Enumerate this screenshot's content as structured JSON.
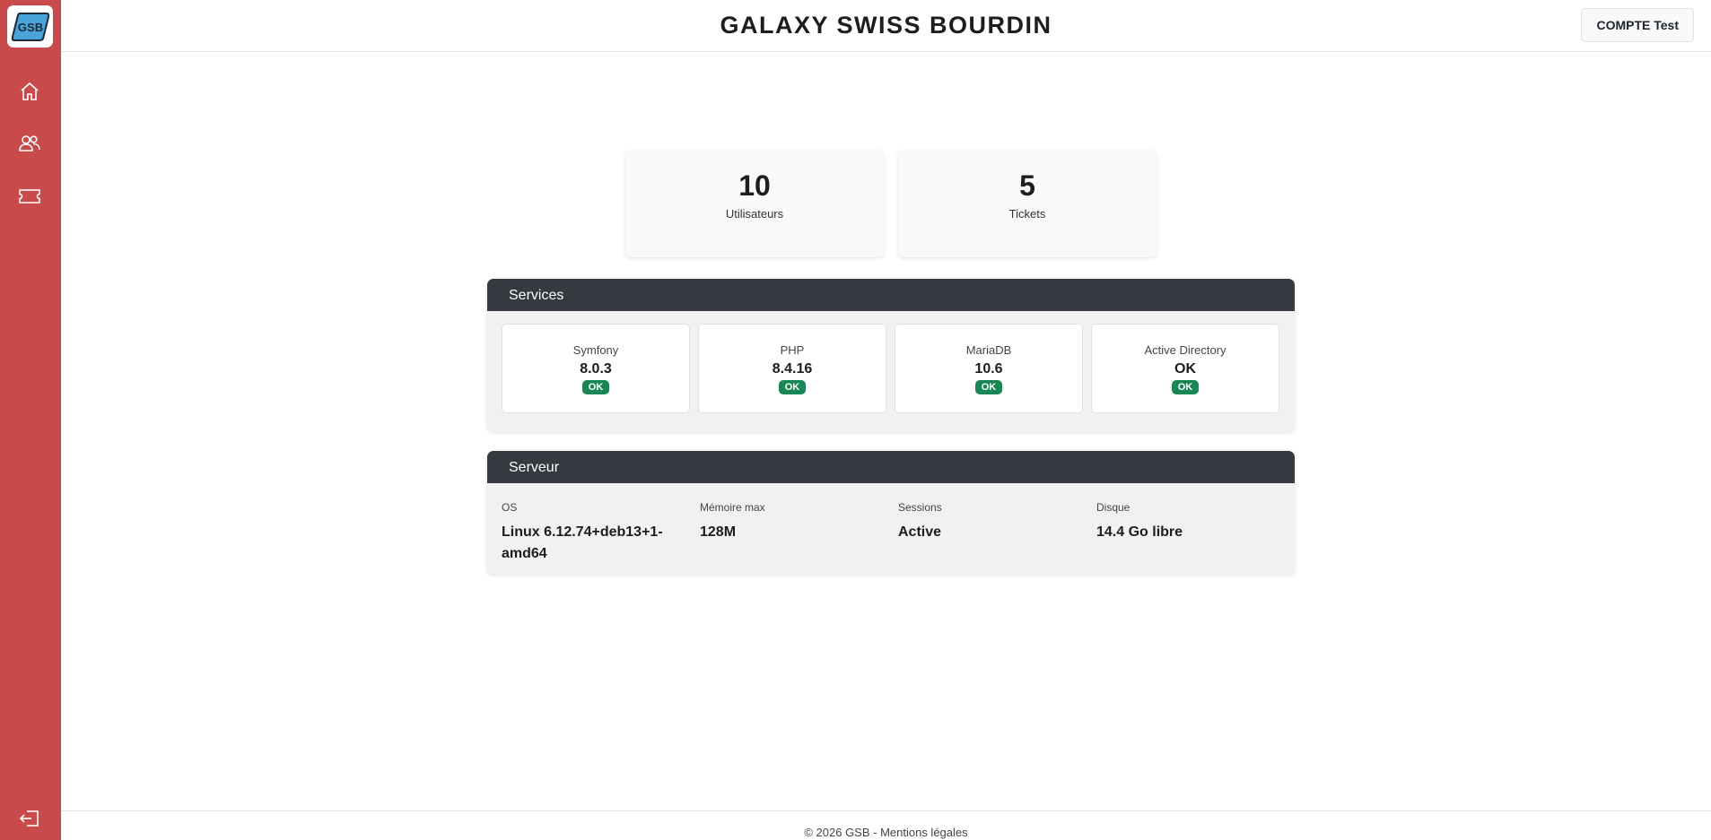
{
  "sidebar": {
    "logo_text": "GSB",
    "items": [
      {
        "icon": "home-icon"
      },
      {
        "icon": "users-icon"
      },
      {
        "icon": "ticket-icon"
      }
    ],
    "logout_icon": "logout-icon",
    "background": "#c94a4a"
  },
  "header": {
    "title": "GALAXY SWISS BOURDIN",
    "account_button": "COMPTE Test"
  },
  "stats": [
    {
      "value": "10",
      "label": "Utilisateurs"
    },
    {
      "value": "5",
      "label": "Tickets"
    }
  ],
  "services": {
    "title": "Services",
    "items": [
      {
        "name": "Symfony",
        "value": "8.0.3",
        "status": "OK"
      },
      {
        "name": "PHP",
        "value": "8.4.16",
        "status": "OK"
      },
      {
        "name": "MariaDB",
        "value": "10.6",
        "status": "OK"
      },
      {
        "name": "Active Directory",
        "value": "OK",
        "status": "OK"
      }
    ]
  },
  "server": {
    "title": "Serveur",
    "items": [
      {
        "label": "OS",
        "value": "Linux 6.12.74+deb13+1-amd64"
      },
      {
        "label": "Mémoire max",
        "value": "128M"
      },
      {
        "label": "Sessions",
        "value": "Active"
      },
      {
        "label": "Disque",
        "value": "14.4 Go libre"
      }
    ]
  },
  "footer": {
    "text": "© 2026 GSB - Mentions légales"
  },
  "colors": {
    "header_dark": "#343a40",
    "ok_badge": "#198754"
  }
}
